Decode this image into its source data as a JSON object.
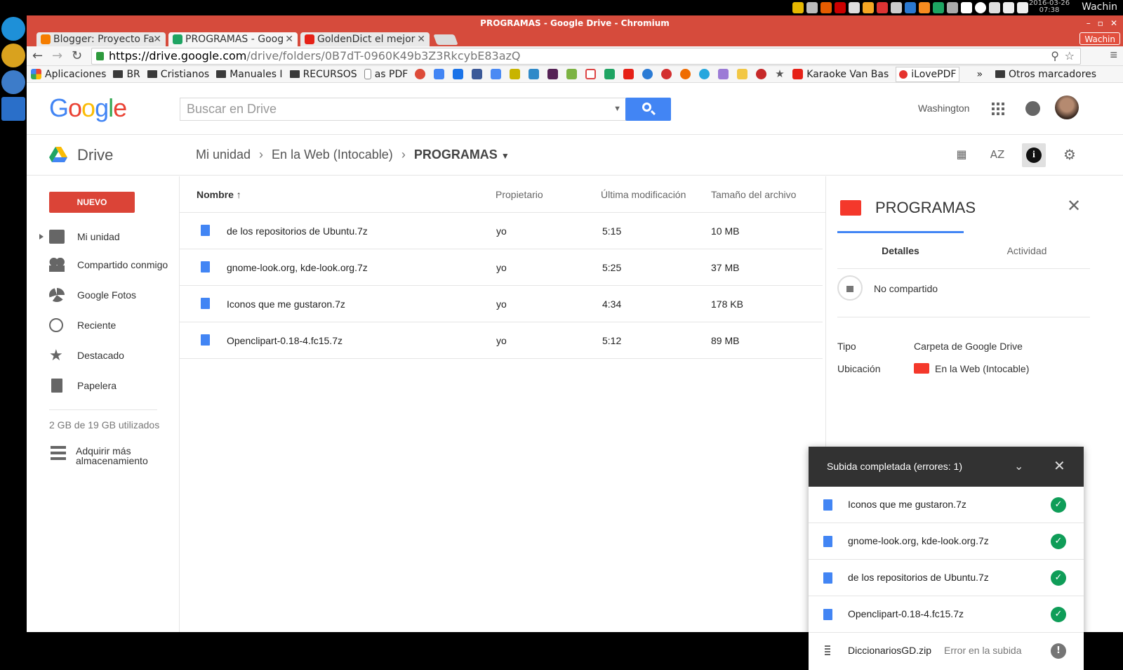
{
  "os": {
    "clock_date": "2016-03-26",
    "clock_time": "07:38",
    "user": "Wachin"
  },
  "window": {
    "title": "PROGRAMAS - Google Drive - Chromium",
    "user_badge": "Wachin",
    "tabs": [
      {
        "label": "Blogger: Proyecto Fa",
        "color": "#f57d00"
      },
      {
        "label": "PROGRAMAS - Goog",
        "color": "#1fa463"
      },
      {
        "label": "GoldenDict el mejor",
        "color": "#e62117"
      }
    ],
    "url_host": "https://drive.google.com",
    "url_path": "/drive/folders/0B7dT-0960K49b3Z3RkcybE83azQ"
  },
  "bookmarks": {
    "apps": "Aplicaciones",
    "items": [
      "BR",
      "Cristianos",
      "Manuales I",
      "RECURSOS",
      "as PDF"
    ],
    "karaoke": "Karaoke Van Bas",
    "ilovepdf": "iLovePDF",
    "overflow": "»",
    "other": "Otros marcadores"
  },
  "header": {
    "logo": "Google",
    "search_placeholder": "Buscar en Drive",
    "account": "Washington"
  },
  "drive": {
    "name": "Drive",
    "breadcrumb": [
      "Mi unidad",
      "En la Web (Intocable)",
      "PROGRAMAS"
    ]
  },
  "sidebar": {
    "new_button": "NUEVO",
    "items": [
      "Mi unidad",
      "Compartido conmigo",
      "Google Fotos",
      "Reciente",
      "Destacado",
      "Papelera"
    ],
    "quota": "2 GB de 19 GB utilizados",
    "buy_storage_1": "Adquirir más",
    "buy_storage_2": "almacenamiento"
  },
  "list": {
    "columns": {
      "name": "Nombre",
      "owner": "Propietario",
      "modified": "Última modificación",
      "size": "Tamaño del archivo"
    },
    "sort_arrow": "↑",
    "rows": [
      {
        "name": "de los repositorios de Ubuntu.7z",
        "owner": "yo",
        "modified": "5:15",
        "size": "10 MB"
      },
      {
        "name": "gnome-look.org, kde-look.org.7z",
        "owner": "yo",
        "modified": "5:25",
        "size": "37 MB"
      },
      {
        "name": "Iconos que me gustaron.7z",
        "owner": "yo",
        "modified": "4:34",
        "size": "178 KB"
      },
      {
        "name": "Openclipart-0.18-4.fc15.7z",
        "owner": "yo",
        "modified": "5:12",
        "size": "89 MB"
      }
    ]
  },
  "details": {
    "title": "PROGRAMAS",
    "tab_details": "Detalles",
    "tab_activity": "Actividad",
    "sharing": "No compartido",
    "type_label": "Tipo",
    "type_value": "Carpeta de Google Drive",
    "location_label": "Ubicación",
    "location_value": "En la Web (Intocable)"
  },
  "upload": {
    "title": "Subida completada (errores: 1)",
    "items": [
      {
        "name": "Iconos que me gustaron.7z"
      },
      {
        "name": "gnome-look.org, kde-look.org.7z"
      },
      {
        "name": "de los repositorios de Ubuntu.7z"
      },
      {
        "name": "Openclipart-0.18-4.fc15.7z"
      }
    ],
    "failed": {
      "name": "DiccionariosGD.zip",
      "status": "Error en la subida"
    },
    "ok_mark": "✓",
    "err_mark": "!"
  }
}
